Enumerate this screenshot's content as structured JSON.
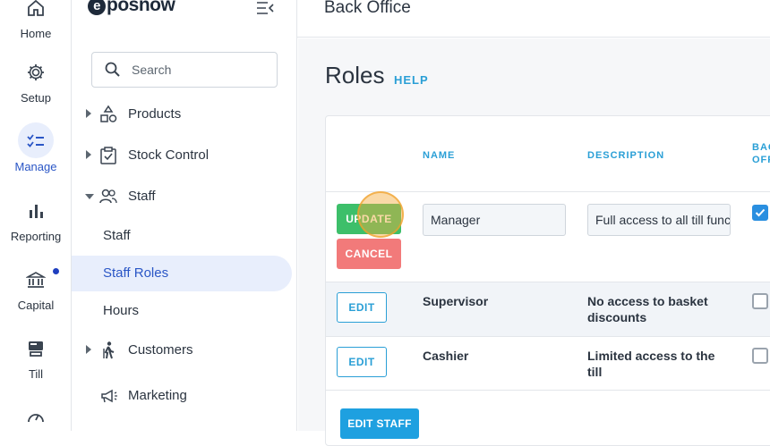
{
  "rail": {
    "items": [
      {
        "label": "Home",
        "icon": "home-icon"
      },
      {
        "label": "Setup",
        "icon": "gear-icon"
      },
      {
        "label": "Manage",
        "icon": "checklist-icon",
        "active": true
      },
      {
        "label": "Reporting",
        "icon": "bar-chart-icon"
      },
      {
        "label": "Capital",
        "icon": "bank-icon",
        "notification_dot": true
      },
      {
        "label": "Till",
        "icon": "till-icon"
      },
      {
        "label": "",
        "icon": "gauge-icon"
      }
    ]
  },
  "sidebar": {
    "logo_text": "posnow",
    "logo_letter": "e",
    "search_placeholder": "Search",
    "nav": [
      {
        "label": "Products",
        "icon": "shapes-icon"
      },
      {
        "label": "Stock Control",
        "icon": "clipboard-check-icon"
      },
      {
        "label": "Staff",
        "icon": "people-icon",
        "expanded": true
      },
      {
        "label": "Customers",
        "icon": "person-walking-icon"
      },
      {
        "label": "Marketing",
        "icon": "megaphone-icon"
      }
    ],
    "staff_sub": [
      {
        "label": "Staff"
      },
      {
        "label": "Staff Roles",
        "selected": true
      },
      {
        "label": "Hours"
      }
    ]
  },
  "topbar": {
    "title": "Back Office"
  },
  "page": {
    "title": "Roles",
    "help": "HELP"
  },
  "table": {
    "headers": {
      "name": "NAME",
      "description": "DESCRIPTION",
      "back_office_1": "BAC",
      "back_office_2": "OFF"
    },
    "editing_row": {
      "update_label": "UPDATE",
      "cancel_label": "CANCEL",
      "name_value": "Manager",
      "description_value": "Full access to all till functions",
      "back_office_checked": true
    },
    "rows": [
      {
        "edit_label": "EDIT",
        "name": "Supervisor",
        "description": "No access to basket discounts",
        "back_office_checked": false
      },
      {
        "edit_label": "EDIT",
        "name": "Cashier",
        "description": "Limited access to the till",
        "back_office_checked": false
      }
    ],
    "edit_staff_label": "EDIT STAFF"
  },
  "colors": {
    "accent": "#2a9fd6",
    "update": "#3dbf6a",
    "cancel": "#f27a7a",
    "active_nav": "#2a56c6"
  }
}
